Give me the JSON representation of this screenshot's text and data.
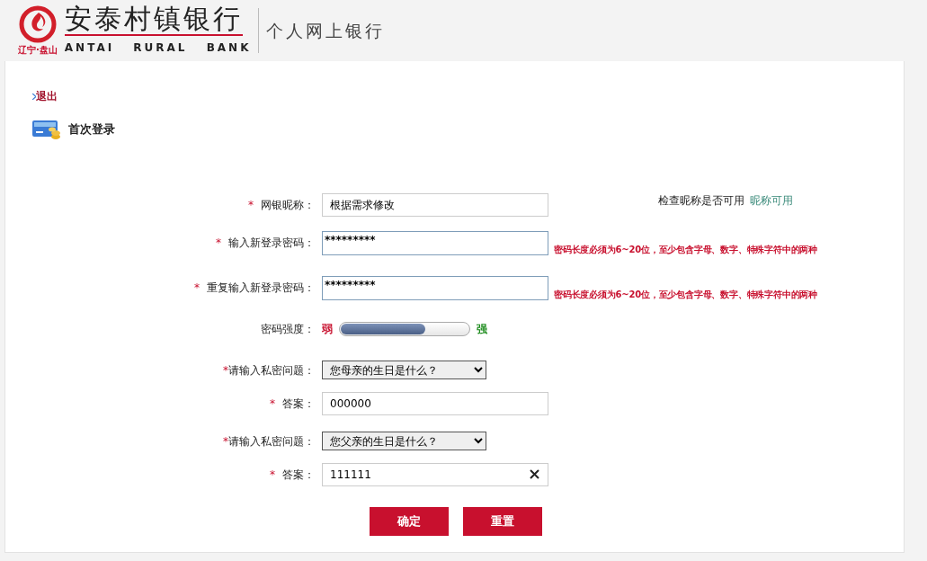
{
  "header": {
    "bank_name": "安泰村镇银行",
    "bank_name_en": "ANTAI RURAL BANK",
    "region": "辽宁·盘山",
    "product": "个人网上银行"
  },
  "logout": "退出",
  "page_title": "首次登录",
  "form_rows": [
    {
      "kind": "text",
      "marker": "*",
      "label": "网银昵称：",
      "value": "根据需求修改",
      "check_label": "检查昵称是否可用",
      "check_result": "昵称可用"
    },
    {
      "kind": "password",
      "marker": "*",
      "label": "输入新登录密码：",
      "value": "*********",
      "hint": "密码长度必须为6~20位，至少包含字母、数字、特殊字符中的两种"
    },
    {
      "kind": "password",
      "marker": "*",
      "label": "重复输入新登录密码：",
      "value": "*********",
      "hint": "密码长度必须为6~20位，至少包含字母、数字、特殊字符中的两种"
    },
    {
      "kind": "strength",
      "label": "密码强度：",
      "weak": "弱",
      "strong": "强",
      "level": 0.66
    },
    {
      "kind": "select",
      "marker": "*",
      "label": "请输入私密问题：",
      "value": "您母亲的生日是什么？"
    },
    {
      "kind": "text",
      "marker": "*",
      "label": "答案：",
      "value": "000000"
    },
    {
      "kind": "select",
      "marker": "*",
      "label": "请输入私密问题：",
      "value": "您父亲的生日是什么？"
    },
    {
      "kind": "text",
      "marker": "*",
      "label": "答案：",
      "value": "111111",
      "clearable": true
    }
  ],
  "buttons": [
    "确定",
    "重置"
  ]
}
